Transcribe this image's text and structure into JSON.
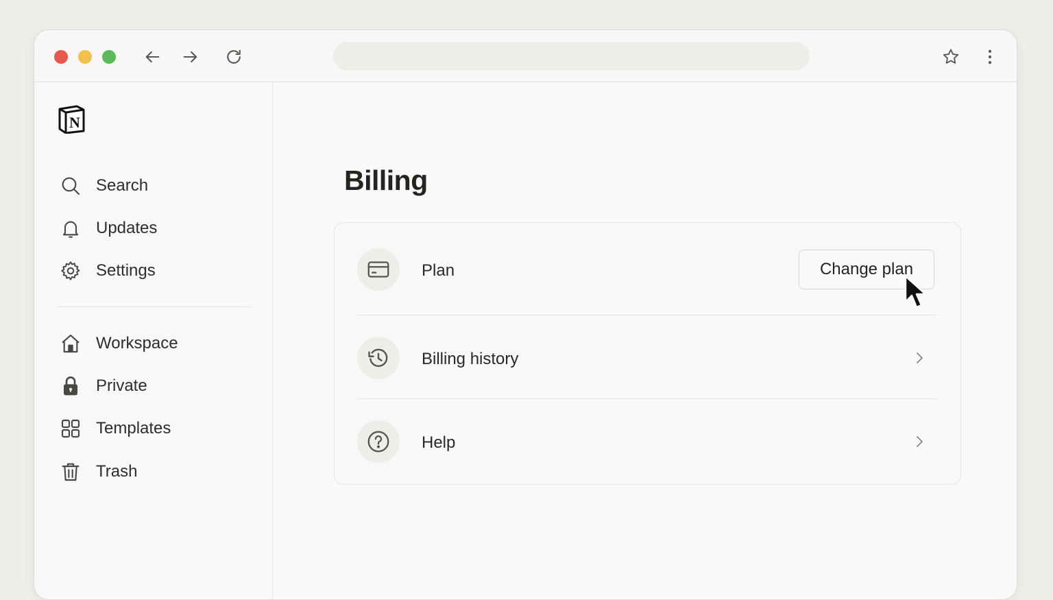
{
  "sidebar": {
    "items": [
      {
        "label": "Search",
        "icon": "search-icon"
      },
      {
        "label": "Updates",
        "icon": "bell-icon"
      },
      {
        "label": "Settings",
        "icon": "gear-icon"
      },
      {
        "label": "Workspace",
        "icon": "home-icon"
      },
      {
        "label": "Private",
        "icon": "lock-icon"
      },
      {
        "label": "Templates",
        "icon": "grid-icon"
      },
      {
        "label": "Trash",
        "icon": "trash-icon"
      }
    ]
  },
  "main": {
    "title": "Billing",
    "rows": [
      {
        "label": "Plan",
        "icon": "credit-card-icon",
        "action_label": "Change plan"
      },
      {
        "label": "Billing history",
        "icon": "history-icon"
      },
      {
        "label": "Help",
        "icon": "help-icon"
      }
    ]
  },
  "colors": {
    "close": "#e6594c",
    "minimize": "#f1c14e",
    "maximize": "#5bbb5a",
    "background": "#efeeeb",
    "window": "#faf9f8"
  }
}
